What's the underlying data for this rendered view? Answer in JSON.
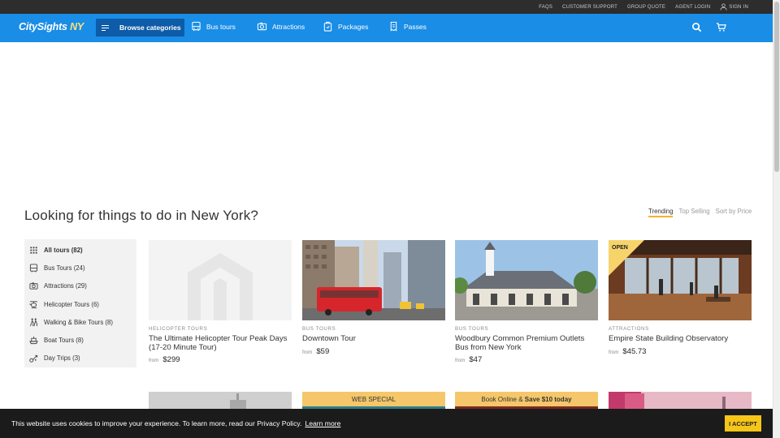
{
  "topbar": {
    "links": [
      "FAQS",
      "CUSTOMER SUPPORT",
      "GROUP QUOTE",
      "AGENT LOGIN"
    ],
    "sign_in": "SIGN IN"
  },
  "nav": {
    "logo_main": "CitySights",
    "logo_ny": "NY",
    "browse_label": "Browse categories",
    "items": [
      {
        "label": "Bus tours",
        "icon": "bus-icon"
      },
      {
        "label": "Attractions",
        "icon": "camera-icon"
      },
      {
        "label": "Packages",
        "icon": "package-icon"
      },
      {
        "label": "Passes",
        "icon": "pass-icon"
      }
    ]
  },
  "main": {
    "heading": "Looking for things to do in New York?",
    "sort_options": [
      "Trending",
      "Top Selling",
      "Sort by Price"
    ],
    "active_sort": "Trending"
  },
  "sidebar": {
    "items": [
      {
        "label": "All tours (82)",
        "icon": "grid-icon"
      },
      {
        "label": "Bus Tours (24)",
        "icon": "bus-icon"
      },
      {
        "label": "Attractions (29)",
        "icon": "camera-icon"
      },
      {
        "label": "Helicopter Tours (6)",
        "icon": "helicopter-icon"
      },
      {
        "label": "Walking & Bike Tours (8)",
        "icon": "walking-icon"
      },
      {
        "label": "Boat Tours (8)",
        "icon": "boat-icon"
      },
      {
        "label": "Day Trips (3)",
        "icon": "daytrip-icon"
      }
    ]
  },
  "cards": [
    {
      "category": "HELICOPTER TOURS",
      "title": "The Ultimate Helicopter Tour Peak Days (17-20 Minute Tour)",
      "from": "from",
      "price": "$299"
    },
    {
      "category": "BUS TOURS",
      "title": "Downtown Tour",
      "from": "from",
      "price": "$59"
    },
    {
      "category": "BUS TOURS",
      "title": "Woodbury Common Premium Outlets Bus from New York",
      "from": "from",
      "price": "$47"
    },
    {
      "category": "ATTRACTIONS",
      "title": "Empire State Building Observatory",
      "from": "from",
      "price": "$45.73",
      "badge": "OPEN"
    }
  ],
  "row2": {
    "web_special": "WEB SPECIAL",
    "book_online": "Book Online &",
    "save": "Save $10 today"
  },
  "cookie": {
    "text": "This website uses cookies to improve your experience. To learn more, read our Privacy Policy.",
    "learn_more": "Learn more",
    "accept": "I ACCEPT"
  },
  "colors": {
    "nav": "#1a8de6",
    "topbar": "#2d2d2d",
    "accent": "#f5c518",
    "browse": "#0e5ba8"
  }
}
